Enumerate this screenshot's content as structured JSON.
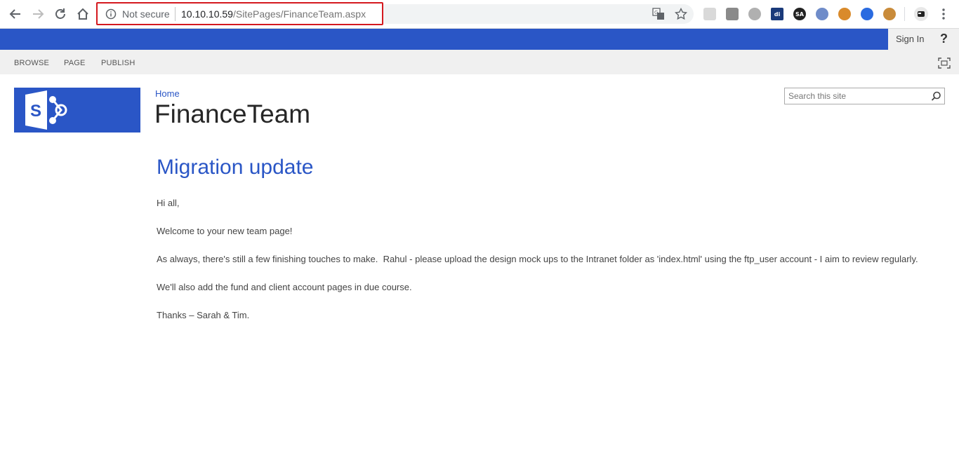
{
  "browser": {
    "security_label": "Not secure",
    "url_host": "10.10.10.59",
    "url_path": "/SitePages/FinanceTeam.aspx",
    "extensions": [
      {
        "icon": "grid-extension-icon",
        "color": "#d9d9d9"
      },
      {
        "icon": "camera-extension-icon",
        "color": "#8a8a8a"
      },
      {
        "icon": "hexagon-extension-icon",
        "color": "#b0b0b0"
      },
      {
        "icon": "chart-extension-icon",
        "color": "#1a3a7a",
        "text": "di"
      },
      {
        "icon": "sa-extension-icon",
        "color": "#222222",
        "text": "SA"
      },
      {
        "icon": "wappalyzer-extension-icon",
        "color": "#6f8cc9"
      },
      {
        "icon": "fox-extension-icon",
        "color": "#d98a2b"
      },
      {
        "icon": "refresh-extension-icon",
        "color": "#2a6be0"
      },
      {
        "icon": "cookie-extension-icon",
        "color": "#c98b3a"
      }
    ]
  },
  "suite_bar": {
    "accent_color": "#2a56c6",
    "sign_in_label": "Sign In",
    "help_label": "?"
  },
  "ribbon": {
    "tabs": [
      "BROWSE",
      "PAGE",
      "PUBLISH"
    ]
  },
  "site": {
    "breadcrumb": "Home",
    "title": "FinanceTeam",
    "search_placeholder": "Search this site"
  },
  "content": {
    "heading": "Migration update",
    "paragraphs": [
      "Hi all,",
      "Welcome to your new team page!",
      "As always, there's still a few finishing touches to make.  Rahul - please upload the design mock ups to the Intranet folder as 'index.html' using the ftp_user account - I aim to review regularly.",
      "We'll also add the fund and client account pages in due course.",
      "Thanks – Sarah & Tim."
    ]
  }
}
